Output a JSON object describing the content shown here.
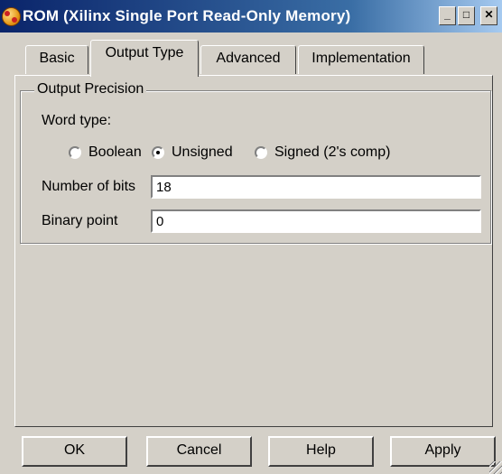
{
  "window": {
    "title": "ROM (Xilinx Single Port Read-Only Memory)",
    "minimize_glyph": "_",
    "maximize_glyph": "□",
    "close_glyph": "✕"
  },
  "tabs": [
    {
      "label": "Basic"
    },
    {
      "label": "Output Type"
    },
    {
      "label": "Advanced"
    },
    {
      "label": "Implementation"
    }
  ],
  "active_tab": "Output Type",
  "output_precision": {
    "legend": "Output Precision",
    "word_type_label": "Word type:",
    "options": [
      {
        "label": "Boolean",
        "checked": false
      },
      {
        "label": "Unsigned",
        "checked": true
      },
      {
        "label": "Signed (2's comp)",
        "checked": false
      }
    ],
    "number_of_bits_label": "Number of bits",
    "number_of_bits_value": "18",
    "binary_point_label": "Binary point",
    "binary_point_value": "0"
  },
  "buttons": {
    "ok": "OK",
    "cancel": "Cancel",
    "help": "Help",
    "apply": "Apply"
  },
  "icons": {
    "app": "xilinx-block-icon",
    "grip": "resize-grip-icon"
  }
}
